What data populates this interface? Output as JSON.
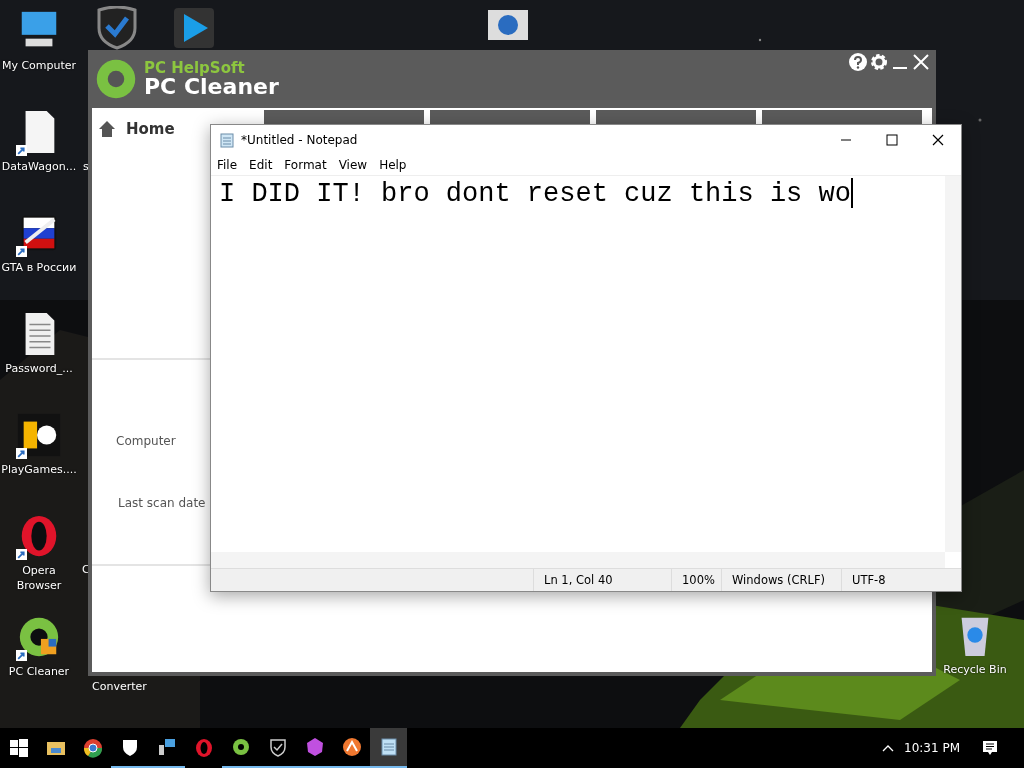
{
  "desktop": {
    "top_icons": [
      {
        "kind": "shield"
      },
      {
        "kind": "play"
      },
      {
        "kind": "info"
      }
    ],
    "icons": [
      {
        "label": "My Computer",
        "kind": "computer",
        "shortcut": false
      },
      {
        "label": "DataWagon...",
        "kind": "file",
        "shortcut": true
      },
      {
        "label": "GTA в России",
        "kind": "flag",
        "shortcut": true
      },
      {
        "label": "Password_...",
        "kind": "document",
        "shortcut": false
      },
      {
        "label": "PlayGames....",
        "kind": "pg",
        "shortcut": true
      },
      {
        "label": "Opera Browser",
        "kind": "opera",
        "shortcut": true
      },
      {
        "label": "PC Cleaner",
        "kind": "leaf",
        "shortcut": true
      }
    ],
    "fragments": [
      "s",
      "C",
      "Converter"
    ],
    "recycle_bin": {
      "label": "Recycle Bin"
    }
  },
  "pc_cleaner": {
    "brand": "PC HelpSoft",
    "title": "PC Cleaner",
    "tab_count_hint": [
      {
        "selected": false
      },
      {
        "selected": false
      },
      {
        "selected": false
      },
      {
        "selected": false
      }
    ],
    "sidebar": [
      {
        "label": "Home",
        "selected": true
      }
    ],
    "details": [
      "Computer",
      "Last scan date"
    ]
  },
  "notepad": {
    "title": "*Untitled - Notepad",
    "menu": [
      "File",
      "Edit",
      "Format",
      "View",
      "Help"
    ],
    "text": "I DID IT! bro dont reset cuz this is wo",
    "status_bar": [
      "Ln 1, Col 40",
      "100%",
      "Windows (CRLF)",
      "UTF-8"
    ]
  },
  "taskbar": {
    "items": [
      {
        "kind": "start",
        "running": false,
        "selected": false
      },
      {
        "kind": "folder",
        "running": false,
        "selected": false
      },
      {
        "kind": "chrome",
        "running": false,
        "selected": false
      },
      {
        "kind": "shield",
        "running": true,
        "selected": false
      },
      {
        "kind": "network",
        "running": true,
        "selected": false
      },
      {
        "kind": "opera",
        "running": false,
        "selected": false
      },
      {
        "kind": "leaf",
        "running": true,
        "selected": false
      },
      {
        "kind": "shieldcheck",
        "running": true,
        "selected": false
      },
      {
        "kind": "pink",
        "running": true,
        "selected": false
      },
      {
        "kind": "orange",
        "running": true,
        "selected": false
      },
      {
        "kind": "notepad",
        "running": true,
        "selected": true
      }
    ],
    "time": "10:31 PM"
  }
}
